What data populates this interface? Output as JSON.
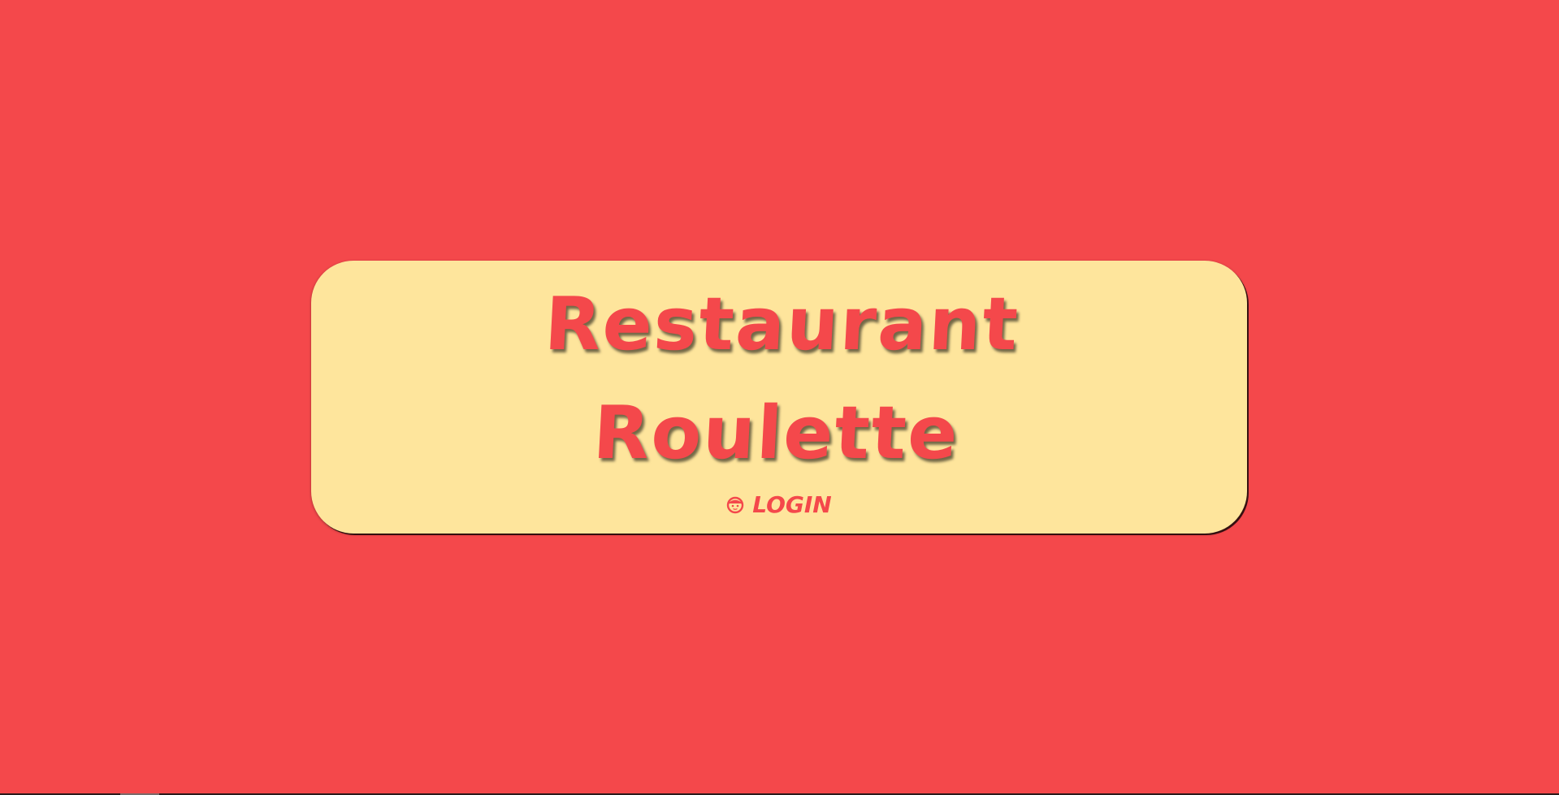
{
  "app": {
    "title_line1": "Restaurant",
    "title_line2": "Roulette"
  },
  "login": {
    "label": "LOGIN",
    "icon": "user-face-icon"
  },
  "colors": {
    "background": "#f4484b",
    "card": "#fee59c",
    "accent": "#f4484b"
  }
}
